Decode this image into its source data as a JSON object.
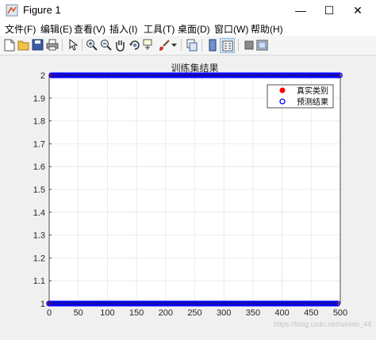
{
  "window": {
    "title": "Figure 1",
    "minimize": "—",
    "maximize": "☐",
    "close": "✕"
  },
  "menu": [
    {
      "label": "文件(F)"
    },
    {
      "label": "编辑(E)"
    },
    {
      "label": "查看(V)"
    },
    {
      "label": "插入(I)"
    },
    {
      "label": "工具(T)"
    },
    {
      "label": "桌面(D)"
    },
    {
      "label": "窗口(W)"
    },
    {
      "label": "帮助(H)"
    }
  ],
  "toolbar": [
    "new-figure-icon",
    "open-file-icon",
    "save-icon",
    "print-icon",
    "edit-plot-arrow-icon",
    "zoom-in-icon",
    "zoom-out-icon",
    "pan-hand-icon",
    "rotate-3d-icon",
    "data-cursor-icon",
    "brush-icon",
    "brush-dropdown-icon",
    "link-plot-icon",
    "insert-colorbar-icon",
    "insert-legend-icon",
    "hide-plot-tools-icon",
    "show-plot-tools-icon"
  ],
  "watermark": "https://blog.csdn.net/weixin_44",
  "chart_data": {
    "type": "scatter",
    "title": "训练集结果",
    "xlim": [
      0,
      500
    ],
    "ylim": [
      1,
      2
    ],
    "xticks": [
      0,
      50,
      100,
      150,
      200,
      250,
      300,
      350,
      400,
      450,
      500
    ],
    "yticks": [
      1,
      1.1,
      1.2,
      1.3,
      1.4,
      1.5,
      1.6,
      1.7,
      1.8,
      1.9,
      2
    ],
    "grid": true,
    "legend_position": "top-right",
    "series": [
      {
        "name": "真实类别",
        "marker": "filled-dot",
        "color": "#ff0000",
        "segments": [
          {
            "y": 2,
            "x_start": 4,
            "x_end": 500,
            "step": 6
          },
          {
            "y": 1,
            "x_start": 0,
            "x_end": 495,
            "step": 6
          }
        ]
      },
      {
        "name": "预测结果",
        "marker": "open-circle",
        "color": "#0000ff",
        "segments": [
          {
            "y": 2,
            "x_start": 4,
            "x_end": 500,
            "step": 3
          },
          {
            "y": 1,
            "x_start": 0,
            "x_end": 495,
            "step": 3
          }
        ]
      }
    ]
  }
}
